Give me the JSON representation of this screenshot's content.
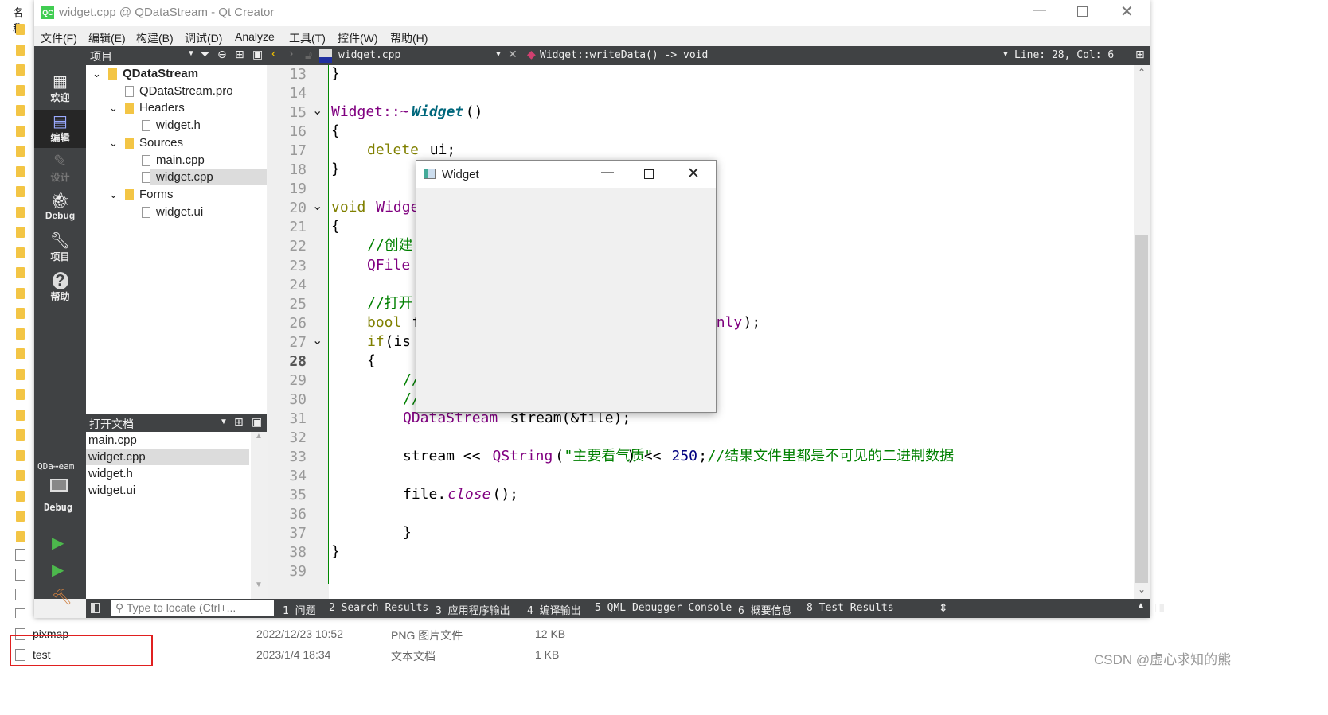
{
  "explorer": {
    "header": "名称",
    "rows": [
      {
        "name": "pixmap",
        "date": "2022/12/23 10:52",
        "type": "PNG 图片文件",
        "size": "12 KB"
      },
      {
        "name": "test",
        "date": "2023/1/4 18:34",
        "type": "文本文档",
        "size": "1 KB"
      }
    ],
    "highlight_color": "#e02020",
    "watermark": "CSDN @虚心求知的熊"
  },
  "window": {
    "title": "widget.cpp @ QDataStream - Qt Creator",
    "icon": "QC"
  },
  "menu": [
    "文件(F)",
    "编辑(E)",
    "构建(B)",
    "调试(D)",
    "Analyze",
    "工具(T)",
    "控件(W)",
    "帮助(H)"
  ],
  "toolbar": {
    "pane_select": "项目",
    "file": "widget.cpp",
    "symbol": "Widget::writeData() -> void",
    "position": "Line: 28, Col: 6"
  },
  "modes": [
    {
      "label": "欢迎",
      "icon": "grid-icon"
    },
    {
      "label": "编辑",
      "icon": "edit-icon",
      "active": true
    },
    {
      "label": "设计",
      "icon": "pencil-icon",
      "disabled": true
    },
    {
      "label": "Debug",
      "icon": "bug-icon"
    },
    {
      "label": "项目",
      "icon": "wrench-icon"
    },
    {
      "label": "帮助",
      "icon": "help-icon"
    }
  ],
  "kit": {
    "project": "QDa⋯eam",
    "config": "Debug"
  },
  "tree": [
    {
      "label": "QDataStream",
      "level": 0,
      "expanded": true,
      "bold": true
    },
    {
      "label": "QDataStream.pro",
      "level": 1
    },
    {
      "label": "Headers",
      "level": 1,
      "expanded": true
    },
    {
      "label": "widget.h",
      "level": 2
    },
    {
      "label": "Sources",
      "level": 1,
      "expanded": true
    },
    {
      "label": "main.cpp",
      "level": 2
    },
    {
      "label": "widget.cpp",
      "level": 2,
      "selected": true
    },
    {
      "label": "Forms",
      "level": 1,
      "expanded": true
    },
    {
      "label": "widget.ui",
      "level": 2
    }
  ],
  "open_docs": {
    "title": "打开文档",
    "items": [
      "main.cpp",
      "widget.cpp",
      "widget.h",
      "widget.ui"
    ],
    "selected": 1
  },
  "editor": {
    "current_line": 28,
    "lines": [
      {
        "n": 13,
        "t": [
          [
            0,
            "}",
            "d"
          ]
        ]
      },
      {
        "n": 14,
        "t": []
      },
      {
        "n": 15,
        "fold": true,
        "t": [
          [
            0,
            "Widget::~",
            "p"
          ],
          [
            9,
            "Widget",
            "f"
          ],
          [
            15,
            "()",
            "d"
          ]
        ]
      },
      {
        "n": 16,
        "t": [
          [
            0,
            "{",
            "d"
          ]
        ]
      },
      {
        "n": 17,
        "t": [
          [
            4,
            "delete",
            "k"
          ],
          [
            11,
            "ui;",
            "d"
          ]
        ]
      },
      {
        "n": 18,
        "t": [
          [
            0,
            "}",
            "d"
          ]
        ]
      },
      {
        "n": 19,
        "t": []
      },
      {
        "n": 20,
        "fold": true,
        "t": [
          [
            0,
            "void",
            "k"
          ],
          [
            5,
            "Widge",
            "p"
          ]
        ]
      },
      {
        "n": 21,
        "t": [
          [
            0,
            "{",
            "d"
          ]
        ]
      },
      {
        "n": 22,
        "t": [
          [
            4,
            "//创建",
            "c"
          ]
        ]
      },
      {
        "n": 23,
        "t": [
          [
            4,
            "QFile",
            "p"
          ]
        ]
      },
      {
        "n": 24,
        "t": []
      },
      {
        "n": 25,
        "t": [
          [
            4,
            "//打开",
            "c"
          ]
        ]
      },
      {
        "n": 26,
        "t": [
          [
            4,
            "bool",
            "k"
          ],
          [
            9,
            "f",
            "d"
          ],
          [
            43,
            "nly",
            "p"
          ],
          [
            46,
            ");",
            "d"
          ]
        ]
      },
      {
        "n": 27,
        "fold": true,
        "t": [
          [
            4,
            "if",
            "k"
          ],
          [
            6,
            "(is",
            "d"
          ]
        ]
      },
      {
        "n": 28,
        "t": [
          [
            4,
            "{",
            "d"
          ]
        ]
      },
      {
        "n": 29,
        "t": [
          [
            8,
            "//",
            "c"
          ]
        ]
      },
      {
        "n": 30,
        "t": [
          [
            8,
            "//",
            "c"
          ]
        ]
      },
      {
        "n": 31,
        "t": [
          [
            8,
            "QDataStream",
            "p"
          ],
          [
            19,
            " stream(&file);",
            "d"
          ]
        ]
      },
      {
        "n": 32,
        "t": []
      },
      {
        "n": 33,
        "t": [
          [
            8,
            "stream << ",
            "d"
          ],
          [
            18,
            "QString",
            "p"
          ],
          [
            25,
            "(",
            "d"
          ],
          [
            26,
            "\"主要看气质\"",
            "c"
          ],
          [
            33,
            ") << ",
            "d"
          ],
          [
            38,
            "250",
            "n"
          ],
          [
            41,
            ";",
            "d"
          ],
          [
            42,
            "//结果文件里都是不可见的二进制数据",
            "c"
          ]
        ]
      },
      {
        "n": 34,
        "t": []
      },
      {
        "n": 35,
        "t": [
          [
            8,
            "file.",
            "d"
          ],
          [
            13,
            "close",
            "i"
          ],
          [
            18,
            "();",
            "d"
          ]
        ]
      },
      {
        "n": 36,
        "t": []
      },
      {
        "n": 37,
        "t": [
          [
            8,
            "}",
            "d"
          ]
        ]
      },
      {
        "n": 38,
        "t": [
          [
            0,
            "}",
            "d"
          ]
        ]
      },
      {
        "n": 39,
        "t": []
      }
    ]
  },
  "colors": {
    "d": "#000000",
    "k": "#808000",
    "p": "#800080",
    "f": "#00677c",
    "c": "#008000",
    "n": "#000080",
    "i": "#800080"
  },
  "locator": {
    "placeholder": "Type to locate (Ctrl+..."
  },
  "output_tabs": [
    "1 问题",
    "2 Search Results",
    "3 应用程序输出",
    "4 编译输出",
    "5 QML Debugger Console",
    "6 概要信息",
    "8 Test Results"
  ],
  "widget_window": {
    "title": "Widget"
  }
}
